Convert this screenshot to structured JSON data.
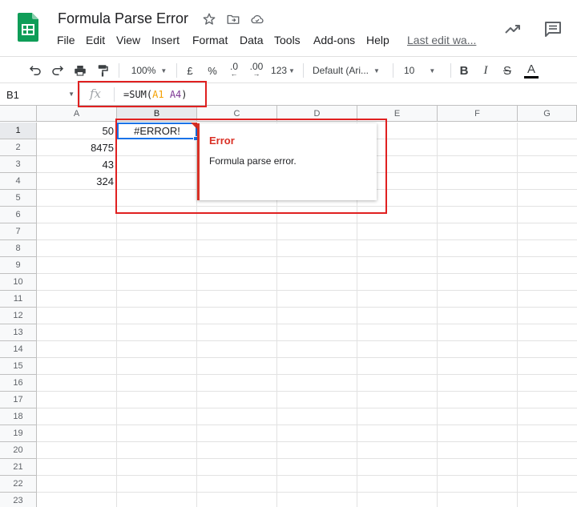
{
  "app": {
    "title": "Formula Parse Error",
    "menu": [
      "File",
      "Edit",
      "View",
      "Insert",
      "Format",
      "Data",
      "Tools",
      "Add-ons",
      "Help"
    ],
    "last_edit": "Last edit wa..."
  },
  "toolbar": {
    "zoom": "100%",
    "currency": "£",
    "percent": "%",
    "decrease_decimal": ".0",
    "increase_decimal": ".00",
    "more_formats": "123",
    "font": "Default (Ari...",
    "font_size": "10",
    "bold": "B",
    "italic": "I",
    "strikethrough": "S",
    "text_color": "A"
  },
  "formula_bar": {
    "name_box": "B1",
    "fx": "fx",
    "formula_prefix": "=SUM(",
    "ref1": "A1",
    "ref2": "A4",
    "formula_suffix": ")"
  },
  "grid": {
    "columns": [
      "A",
      "B",
      "C",
      "D",
      "E",
      "F",
      "G"
    ],
    "rows": [
      "1",
      "2",
      "3",
      "4",
      "5",
      "6",
      "7",
      "8",
      "9",
      "10",
      "11",
      "12",
      "13",
      "14",
      "15",
      "16",
      "17",
      "18",
      "19",
      "20",
      "21",
      "22",
      "23"
    ],
    "col_a_values": [
      "50",
      "8475",
      "43",
      "324"
    ],
    "b1_value": "#ERROR!"
  },
  "error_popup": {
    "title": "Error",
    "message": "Formula parse error."
  },
  "colors": {
    "brand_green": "#0f9d58",
    "selection_blue": "#1a73e8",
    "error_red": "#d93025",
    "annotation_red": "#e02020",
    "ref1_color": "#f4a000",
    "ref2_color": "#7e3794"
  }
}
